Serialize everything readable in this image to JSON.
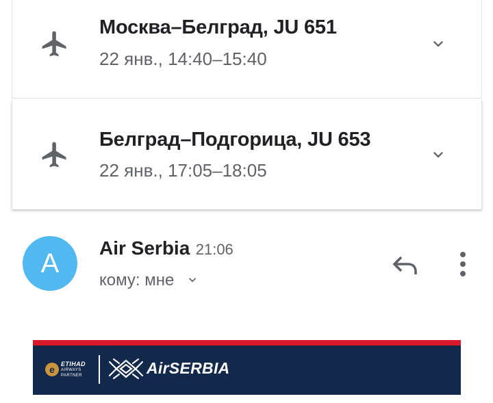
{
  "flights": [
    {
      "icon": "airplane-icon",
      "route": "Москва–Белград, JU 651",
      "time": "22 янв., 14:40–15:40"
    },
    {
      "icon": "airplane-icon",
      "route": "Белград–Подгорица, JU 653",
      "time": "22 янв., 17:05–18:05"
    }
  ],
  "email": {
    "avatar_letter": "A",
    "avatar_color": "#52b8f0",
    "sender": "Air Serbia",
    "time": "21:06",
    "recipient": "кому: мне",
    "actions": [
      "reply-icon",
      "more-vert-icon"
    ]
  },
  "banner": {
    "partner_lines": [
      "ETIHAD",
      "AIRWAYS",
      "PARTNER"
    ],
    "brand": "AirSERBIA",
    "stripe_color": "#d7192d",
    "background_color": "#13294b"
  },
  "colors": {
    "text_primary": "#202124",
    "text_secondary": "#5f6368",
    "icon": "#5f6368"
  }
}
